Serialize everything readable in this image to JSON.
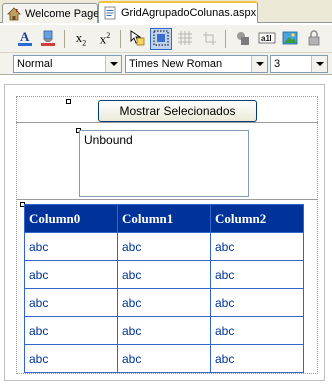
{
  "tabs": [
    {
      "label": "Welcome Page",
      "icon": "home-icon",
      "active": false
    },
    {
      "label": "GridAgrupadoColunas.aspx",
      "icon": "aspx-file-icon",
      "active": true
    }
  ],
  "toolbar": {
    "buttons": [
      "text-color-icon",
      "highlight-icon",
      "subscript-icon",
      "superscript-icon",
      "absolute-position-icon",
      "show-borders-icon",
      "show-grid-icon",
      "snap-to-grid-icon",
      "lock-element-icon",
      "label-icon",
      "insert-image-icon",
      "lock-icon"
    ]
  },
  "format": {
    "block_format": "Normal",
    "font_name": "Times New Roman",
    "font_size": "3"
  },
  "design": {
    "button_label": "Mostrar Selecionados",
    "listbox_text": "Unbound",
    "grid": {
      "columns": [
        "Column0",
        "Column1",
        "Column2"
      ],
      "rows": [
        [
          "abc",
          "abc",
          "abc"
        ],
        [
          "abc",
          "abc",
          "abc"
        ],
        [
          "abc",
          "abc",
          "abc"
        ],
        [
          "abc",
          "abc",
          "abc"
        ],
        [
          "abc",
          "abc",
          "abc"
        ]
      ]
    }
  },
  "colors": {
    "grid_header_bg": "#003399",
    "grid_header_text": "#ffffff",
    "grid_cell_text": "#003399",
    "grid_border": "#3366cc",
    "active_tab_accent": "#f1c13f"
  }
}
